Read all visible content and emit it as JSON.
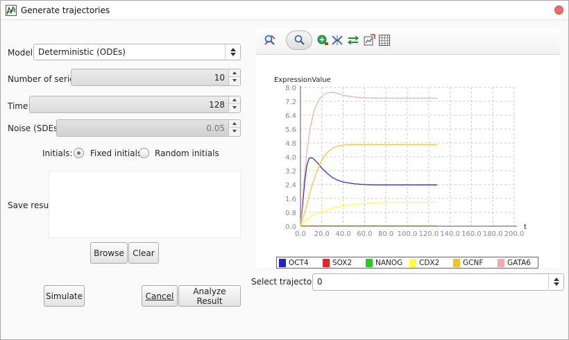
{
  "window": {
    "title": "Generate trajectories"
  },
  "left_panel": {
    "model_label": "Model:",
    "model_value": "Deterministic (ODEs)",
    "series_label": "Number of series:",
    "series_value": "10",
    "time_label": "Time:",
    "time_value": "128",
    "noise_label": "Noise (SDEs):",
    "noise_value": "0.05",
    "initials_label": "Initials:",
    "fixed_initials_label": "Fixed initials",
    "random_initials_label": "Random initials",
    "fixed_initials_selected": true,
    "save_result_label": "Save result:",
    "browse_label": "Browse",
    "clear_label": "Clear",
    "simulate_label": "Simulate",
    "cancel_label": "Cancel",
    "analyze_label": "Analyze Result"
  },
  "toolbar": {
    "icons": [
      "zoom-reset-icon",
      "zoom-icon",
      "pan-icon",
      "fit-icon",
      "axis-settings-icon",
      "export-icon",
      "grid-icon"
    ]
  },
  "right_panel": {
    "select_trajectory_label": "Select trajectory:",
    "select_trajectory_value": "0"
  },
  "chart_data": {
    "type": "line",
    "ylabel": "ExpressionValue",
    "xlabel": "t",
    "xlim": [
      0,
      200
    ],
    "ylim": [
      0,
      8
    ],
    "grid": true,
    "legend": "bottom",
    "x_ticks": [
      "0.0",
      "20.0",
      "40.0",
      "60.0",
      "80.0",
      "100.0",
      "120.0",
      "140.0",
      "160.0",
      "180.0",
      "200.0"
    ],
    "y_ticks": [
      "0.0",
      "0.8",
      "1.6",
      "2.4",
      "3.2",
      "4.0",
      "4.8",
      "5.6",
      "6.4",
      "7.2",
      "8.0"
    ],
    "series": [
      {
        "name": "OCT4",
        "color": "#2222cc",
        "x": [
          0,
          2,
          4,
          6,
          8,
          10,
          12,
          16,
          20,
          25,
          30,
          35,
          40,
          50,
          60,
          70,
          80,
          100,
          128
        ],
        "y": [
          0,
          1.2,
          2.6,
          3.5,
          3.9,
          3.95,
          3.9,
          3.65,
          3.35,
          3.05,
          2.8,
          2.65,
          2.55,
          2.45,
          2.4,
          2.38,
          2.38,
          2.38,
          2.38
        ]
      },
      {
        "name": "SOX2",
        "color": "#ee2222",
        "x": [
          0,
          128
        ],
        "y": [
          0.01,
          0.01
        ]
      },
      {
        "name": "NANOG",
        "color": "#22cc22",
        "x": [
          0,
          128
        ],
        "y": [
          0.02,
          0.02
        ]
      },
      {
        "name": "CDX2",
        "color": "#ffff33",
        "x": [
          0,
          10,
          20,
          30,
          40,
          50,
          60,
          70,
          80,
          100,
          128
        ],
        "y": [
          0,
          0.6,
          0.85,
          1.05,
          1.18,
          1.26,
          1.32,
          1.35,
          1.37,
          1.38,
          1.38
        ]
      },
      {
        "name": "GCNF",
        "color": "#f2c12e",
        "x": [
          0,
          5,
          10,
          15,
          20,
          25,
          30,
          35,
          40,
          50,
          60,
          80,
          100,
          128
        ],
        "y": [
          0,
          1.0,
          2.2,
          3.1,
          3.8,
          4.25,
          4.5,
          4.62,
          4.68,
          4.7,
          4.7,
          4.7,
          4.7,
          4.7
        ]
      },
      {
        "name": "GATA6",
        "color": "#f4a8a8",
        "x": [
          0,
          3,
          6,
          9,
          12,
          15,
          18,
          22,
          26,
          30,
          35,
          40,
          50,
          60,
          80,
          100,
          128
        ],
        "y": [
          0,
          2.4,
          4.3,
          5.6,
          6.5,
          7.0,
          7.35,
          7.6,
          7.7,
          7.72,
          7.65,
          7.55,
          7.45,
          7.4,
          7.38,
          7.38,
          7.38
        ]
      }
    ]
  }
}
